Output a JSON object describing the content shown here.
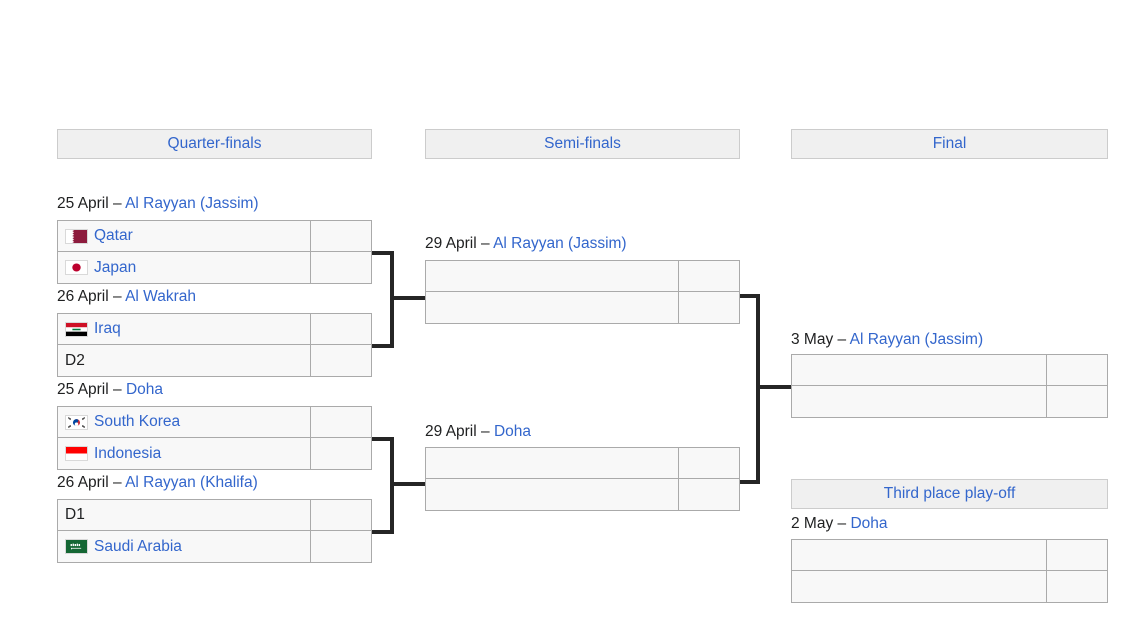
{
  "rounds": [
    {
      "label": "Quarter-finals"
    },
    {
      "label": "Semi-finals"
    },
    {
      "label": "Final"
    },
    {
      "label": "Third place play-off"
    }
  ],
  "matches": {
    "qf1": {
      "date": "25 April",
      "dash": "–",
      "venue": "Al Rayyan (Jassim)",
      "team1": {
        "name": "Qatar",
        "flag": "qatar",
        "score": ""
      },
      "team2": {
        "name": "Japan",
        "flag": "japan",
        "score": ""
      }
    },
    "qf2": {
      "date": "26 April",
      "dash": "–",
      "venue": "Al Wakrah",
      "team1": {
        "name": "Iraq",
        "flag": "iraq",
        "score": ""
      },
      "team2": {
        "name": "D2",
        "flag": "none",
        "score": ""
      }
    },
    "qf3": {
      "date": "25 April",
      "dash": "–",
      "venue": "Doha",
      "team1": {
        "name": "South Korea",
        "flag": "south-korea",
        "score": ""
      },
      "team2": {
        "name": "Indonesia",
        "flag": "indonesia",
        "score": ""
      }
    },
    "qf4": {
      "date": "26 April",
      "dash": "–",
      "venue": "Al Rayyan (Khalifa)",
      "team1": {
        "name": "D1",
        "flag": "none",
        "score": ""
      },
      "team2": {
        "name": "Saudi Arabia",
        "flag": "saudi-arabia",
        "score": ""
      }
    },
    "sf1": {
      "date": "29 April",
      "dash": "–",
      "venue": "Al Rayyan (Jassim)",
      "team1": {
        "name": "",
        "flag": "none",
        "score": ""
      },
      "team2": {
        "name": "",
        "flag": "none",
        "score": ""
      }
    },
    "sf2": {
      "date": "29 April",
      "dash": "–",
      "venue": "Doha",
      "team1": {
        "name": "",
        "flag": "none",
        "score": ""
      },
      "team2": {
        "name": "",
        "flag": "none",
        "score": ""
      }
    },
    "final": {
      "date": "3 May",
      "dash": "–",
      "venue": "Al Rayyan (Jassim)",
      "team1": {
        "name": "",
        "flag": "none",
        "score": ""
      },
      "team2": {
        "name": "",
        "flag": "none",
        "score": ""
      }
    },
    "third": {
      "date": "2 May",
      "dash": "–",
      "venue": "Doha",
      "team1": {
        "name": "",
        "flag": "none",
        "score": ""
      },
      "team2": {
        "name": "",
        "flag": "none",
        "score": ""
      }
    }
  },
  "colors": {
    "link": "#3366cc",
    "text": "#202122",
    "cell_bg": "#f8f8f8",
    "cell_border": "#aaaaaa",
    "header_bg": "#f0f0f0",
    "connector": "#252525"
  }
}
